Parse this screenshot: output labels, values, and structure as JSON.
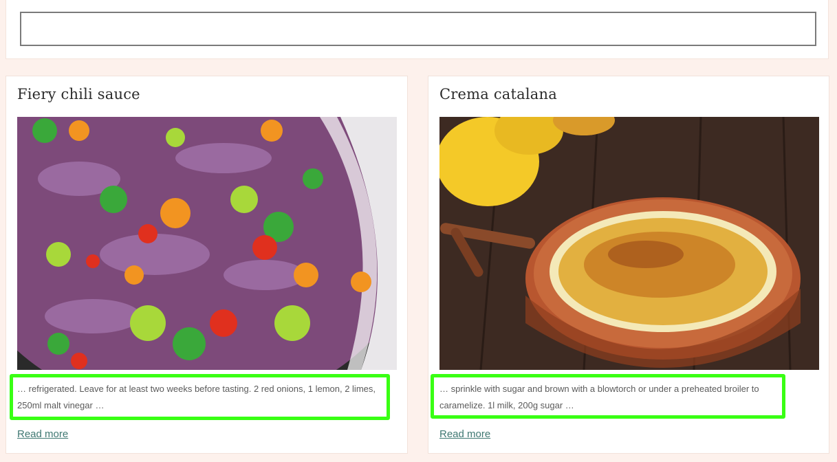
{
  "search": {
    "value": "",
    "placeholder": ""
  },
  "cards": [
    {
      "title": "Fiery chili sauce",
      "image": "chili-peppers-onions-image",
      "excerpt": "… refrigerated. Leave for at least two weeks before tasting. 2 red onions, 1 lemon, 2 limes, 250ml malt vinegar …",
      "read_more": "Read more"
    },
    {
      "title": "Crema catalana",
      "image": "crema-catalana-dessert-image",
      "excerpt": "… sprinkle with sugar and brown with a blowtorch or under a preheated broiler to caramelize. 1l milk, 200g sugar …",
      "read_more": "Read more"
    }
  ],
  "colors": {
    "background": "#fdf1ec",
    "card": "#ffffff",
    "link": "#3f7872",
    "highlight": "#39ff14"
  }
}
